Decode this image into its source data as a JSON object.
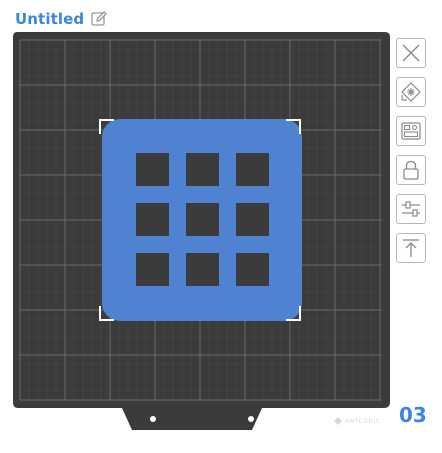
{
  "header": {
    "title": "Untitled",
    "edit_icon": "pencil-edit-icon"
  },
  "plate": {
    "number": "03",
    "brand": "ANYCUBIC",
    "colors": {
      "plate": "#3b3b3b",
      "grid": "#5a5a5a",
      "model": "#4f83d1",
      "accent": "#3a86e0"
    },
    "model": {
      "description_icon": "grid-tray-model",
      "selected": true
    }
  },
  "toolbar": {
    "items": [
      {
        "name": "close-icon"
      },
      {
        "name": "auto-arrange-icon"
      },
      {
        "name": "layout-icon"
      },
      {
        "name": "lock-icon"
      },
      {
        "name": "settings-sliders-icon"
      },
      {
        "name": "move-to-top-icon"
      }
    ]
  }
}
